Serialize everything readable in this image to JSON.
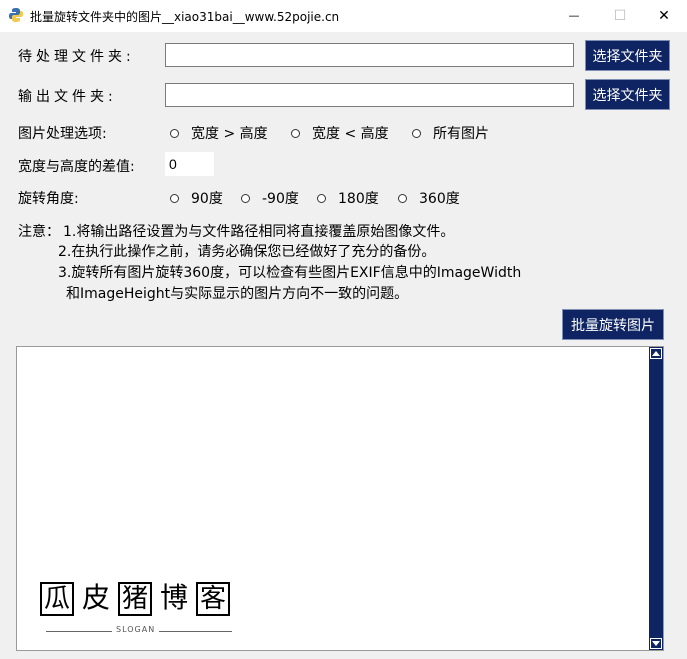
{
  "window": {
    "title": "批量旋转文件夹中的图片__xiao31bai__www.52pojie.cn",
    "minimize_glyph": "—",
    "maximize_glyph": "☐",
    "close_glyph": "✕"
  },
  "input_folder": {
    "label": "待处理文件夹:",
    "value": "",
    "button": "选择文件夹"
  },
  "output_folder": {
    "label": "输出文件夹:",
    "value": "",
    "button": "选择文件夹"
  },
  "image_options": {
    "label": "图片处理选项:",
    "options": [
      "宽度 > 高度",
      "宽度 < 高度",
      "所有图片"
    ]
  },
  "difference": {
    "label": "宽度与高度的差值:",
    "value": "0"
  },
  "rotation": {
    "label": "旋转角度:",
    "options": [
      "90度",
      "-90度",
      "180度",
      "360度"
    ]
  },
  "notes": {
    "prefix": "注意：",
    "line1": "1.将输出路径设置为与文件路径相同将直接覆盖原始图像文件。",
    "line2": "2.在执行此操作之前，请务必确保您已经做好了充分的备份。",
    "line3": "3.旋转所有图片旋转360度，可以检查有些图片EXIF信息中的ImageWidth",
    "line4": "和ImageHeight与实际显示的图片方向不一致的问题。"
  },
  "run_button": "批量旋转图片",
  "output_log": "",
  "logo": {
    "characters": [
      "瓜",
      "皮",
      "猪",
      "博",
      "客"
    ],
    "slogan": "SLOGAN"
  },
  "colors": {
    "accent": "#0e2463",
    "background": "#f0f0f0"
  }
}
